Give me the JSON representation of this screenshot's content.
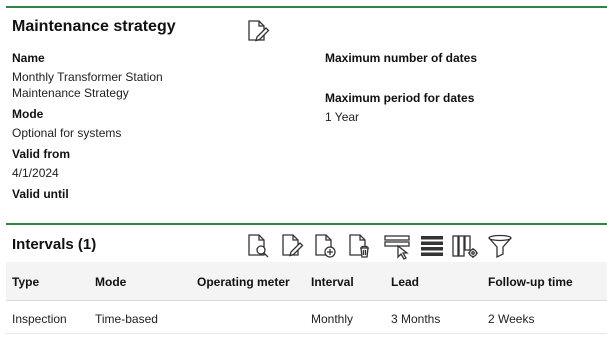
{
  "strategy": {
    "title": "Maintenance strategy",
    "name_label": "Name",
    "name_value_line1": "Monthly Transformer Station",
    "name_value_line2": "Maintenance Strategy",
    "mode_label": "Mode",
    "mode_value": "Optional for systems",
    "valid_from_label": "Valid from",
    "valid_from_value": "4/1/2024",
    "valid_until_label": "Valid until",
    "max_dates_label": "Maximum number of dates",
    "max_period_label": "Maximum period for dates",
    "max_period_value": "1 Year"
  },
  "intervals": {
    "title": "Intervals (1)",
    "columns": [
      "Type",
      "Mode",
      "Operating meter",
      "Interval",
      "Lead",
      "Follow-up time"
    ],
    "rows": [
      [
        "Inspection",
        "Time-based",
        "",
        "Monthly",
        "3 Months",
        "2 Weeks"
      ]
    ]
  },
  "icons": {
    "edit": "edit-document-icon",
    "view": "view-document-icon",
    "add": "add-document-icon",
    "delete": "delete-document-icon",
    "select_rows": "select-rows-icon",
    "density": "row-density-icon",
    "columns": "column-settings-icon",
    "filter": "filter-icon"
  },
  "colors": {
    "accent": "#2e8540"
  }
}
